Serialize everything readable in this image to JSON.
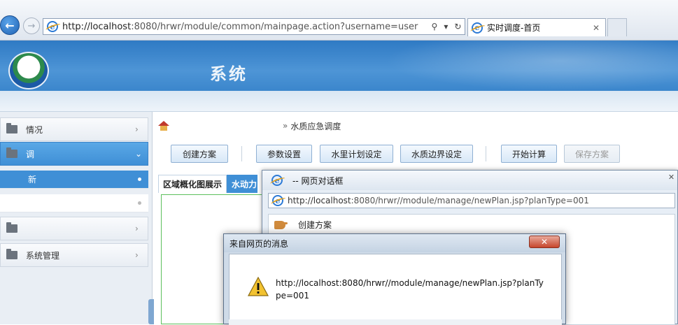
{
  "browser": {
    "address_url_prefix": "http://",
    "address_url_host": "localhost",
    "address_url_rest": ":8080/hrwr/module/common/mainpage.action?username=user",
    "search_icon": "search-icon",
    "refresh_icon": "refresh-icon",
    "tab_title": "实时调度-首页",
    "tab_close": "✕"
  },
  "header": {
    "title": "系统"
  },
  "sidebar": {
    "items": [
      {
        "label": "情况",
        "chevron": "›"
      },
      {
        "label": "调",
        "chevron": "⌄"
      },
      {
        "label": "新",
        "chevron": "•"
      },
      {
        "label": "",
        "chevron": "•"
      },
      {
        "label": "",
        "chevron": "›"
      },
      {
        "label": "系统管理",
        "chevron": "›"
      }
    ]
  },
  "breadcrumb": {
    "sep": "»",
    "current": "水质应急调度"
  },
  "toolbar": {
    "create_plan": "创建方案",
    "param_settings": "参数设置",
    "water_plan": "水里计划设定",
    "quality_boundary": "水质边界设定",
    "start_calc": "开始计算",
    "save_plan": "保存方案"
  },
  "content_tabs": {
    "overview": "区域概化图展示",
    "dynamic": "水动力"
  },
  "web_dialog": {
    "title": "-- 网页对话框",
    "close": "✕",
    "url_prefix": "http://",
    "url_host": "localhost",
    "url_rest": ":8080/hrwr//module/manage/newPlan.jsp?planType=001",
    "heading": "创建方案"
  },
  "message_box": {
    "title": "来自网页的消息",
    "close": "✕",
    "message": "http://localhost:8080/hrwr//module/manage/newPlan.jsp?planType=001"
  },
  "colors": {
    "accent_blue": "#3f8fd6",
    "header_blue": "#2f7ac4",
    "panel_green_border": "#5cbf5c",
    "close_red": "#c6452c"
  }
}
